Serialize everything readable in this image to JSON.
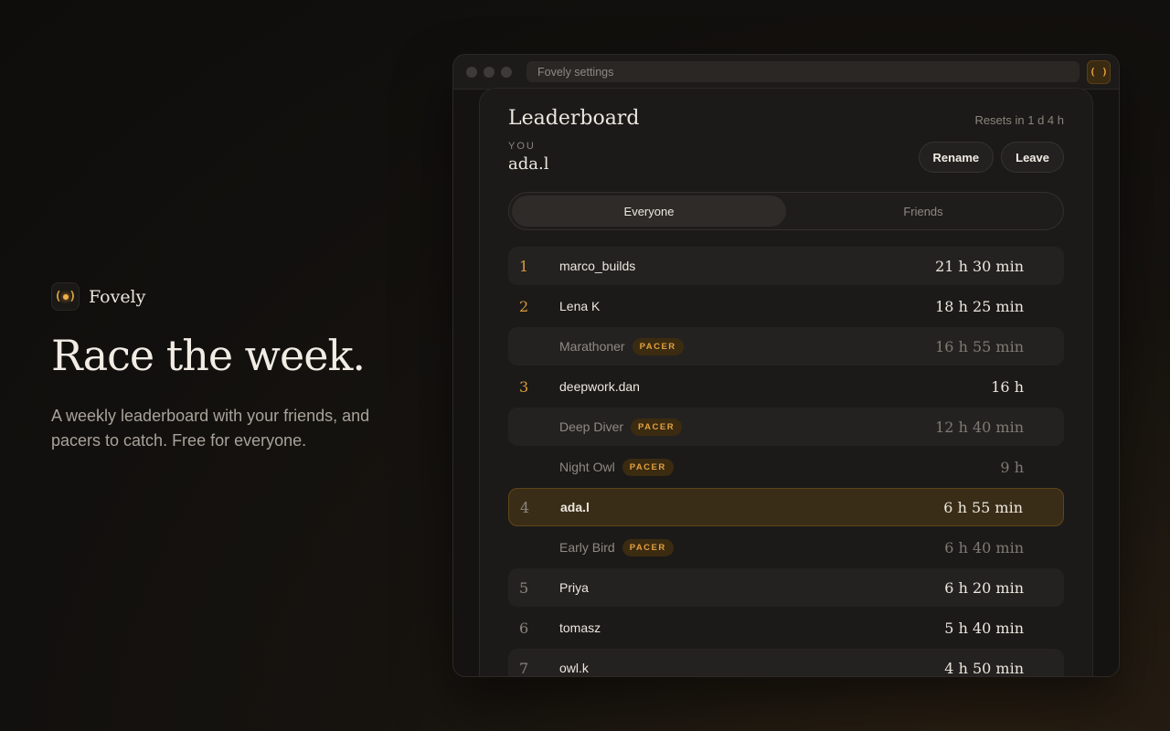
{
  "hero": {
    "brand_name": "Fovely",
    "title": "Race the week.",
    "subtitle": "A weekly leaderboard with your friends, and pacers to catch. Free for everyone."
  },
  "window": {
    "url": "Fovely settings",
    "extension_icon": "fovely-extension-icon"
  },
  "leaderboard": {
    "title": "Leaderboard",
    "resets": "Resets in 1 d 4 h",
    "you_label": "YOU",
    "you_name": "ada.l",
    "rename_label": "Rename",
    "leave_label": "Leave",
    "tabs": [
      {
        "label": "Everyone",
        "active": true
      },
      {
        "label": "Friends",
        "active": false
      }
    ],
    "rows": [
      {
        "rank": "1",
        "name": "marco_builds",
        "time": "21 h 30 min",
        "pacer": false
      },
      {
        "rank": "2",
        "name": "Lena K",
        "time": "18 h 25 min",
        "pacer": false
      },
      {
        "rank": "",
        "name": "Marathoner",
        "badge": "PACER",
        "time": "16 h 55 min",
        "pacer": true
      },
      {
        "rank": "3",
        "name": "deepwork.dan",
        "time": "16 h",
        "pacer": false
      },
      {
        "rank": "",
        "name": "Deep Diver",
        "badge": "PACER",
        "time": "12 h 40 min",
        "pacer": true
      },
      {
        "rank": "",
        "name": "Night Owl",
        "badge": "PACER",
        "time": "9 h",
        "pacer": true
      },
      {
        "rank": "4",
        "name": "ada.l",
        "time": "6 h 55 min",
        "pacer": false,
        "me": true
      },
      {
        "rank": "",
        "name": "Early Bird",
        "badge": "PACER",
        "time": "6 h 40 min",
        "pacer": true
      },
      {
        "rank": "5",
        "name": "Priya",
        "time": "6 h 20 min",
        "pacer": false
      },
      {
        "rank": "6",
        "name": "tomasz",
        "time": "5 h 40 min",
        "pacer": false
      },
      {
        "rank": "7",
        "name": "owl.k",
        "time": "4 h 50 min",
        "pacer": false
      }
    ]
  },
  "colors": {
    "accent": "#d99a3c",
    "highlight_row": "#3a2d17"
  }
}
